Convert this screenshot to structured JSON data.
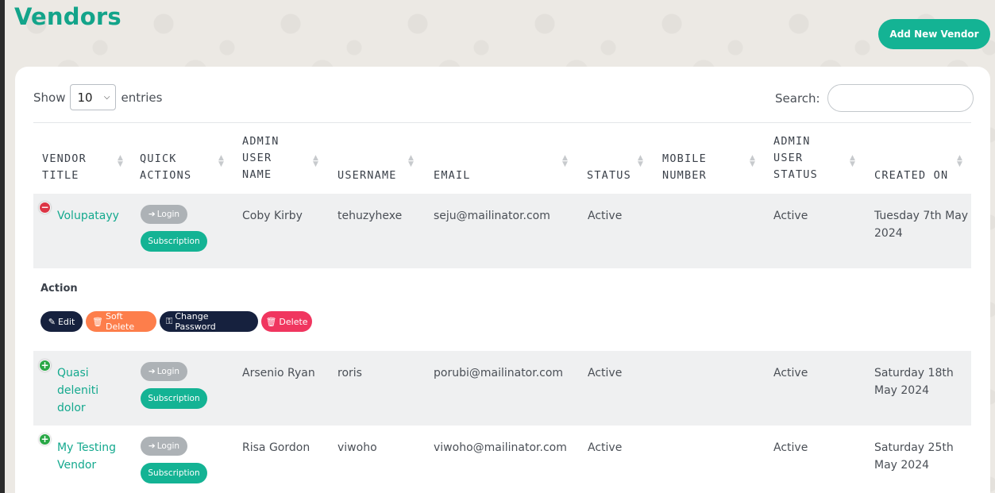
{
  "page": {
    "title": "Vendors",
    "add_button": "Add New Vendor"
  },
  "table_controls": {
    "show_label": "Show",
    "entries_value": "10",
    "entries_label": "entries",
    "search_label": "Search:",
    "search_value": ""
  },
  "columns": [
    [
      "VENDOR",
      "TITLE"
    ],
    [
      "QUICK",
      "ACTIONS"
    ],
    [
      "ADMIN",
      "USER",
      "NAME"
    ],
    [
      "USERNAME"
    ],
    [
      "EMAIL"
    ],
    [
      "STATUS"
    ],
    [
      "MOBILE",
      "NUMBER"
    ],
    [
      "ADMIN",
      "USER",
      "STATUS"
    ],
    [
      "CREATED ON"
    ]
  ],
  "quick_actions": {
    "login": "Login",
    "subscription": "Subscription"
  },
  "rows": [
    {
      "title_lines": [
        "Volupatayy"
      ],
      "expanded": true,
      "admin_user_name": "Coby Kirby",
      "username": "tehuzyhexe",
      "email": "seju@mailinator.com",
      "status": "Active",
      "mobile": "",
      "admin_status": "Active",
      "created_lines": [
        "Tuesday 7th May",
        "2024"
      ]
    },
    {
      "title_lines": [
        "Quasi",
        "deleniti",
        "dolor"
      ],
      "expanded": false,
      "admin_user_name": "Arsenio Ryan",
      "username": "roris",
      "email": "porubi@mailinator.com",
      "status": "Active",
      "mobile": "",
      "admin_status": "Active",
      "created_lines": [
        "Saturday 18th",
        "May 2024"
      ]
    },
    {
      "title_lines": [
        "My Testing",
        "Vendor"
      ],
      "expanded": false,
      "admin_user_name": "Risa Gordon",
      "username": "viwoho",
      "email": "viwoho@mailinator.com",
      "status": "Active",
      "mobile": "",
      "admin_status": "Active",
      "created_lines": [
        "Saturday 25th",
        "May 2024"
      ]
    }
  ],
  "child_row": {
    "label": "Action",
    "buttons": {
      "edit": "Edit",
      "soft_delete": "Soft Delete",
      "change_password": "Change Password",
      "delete": "Delete"
    }
  },
  "colors": {
    "brand": "#14b394",
    "title": "#13a48a",
    "navy": "#16213e",
    "orange": "#fd7e4b",
    "pink": "#f0365f",
    "grey_pill": "#adb2b6"
  }
}
